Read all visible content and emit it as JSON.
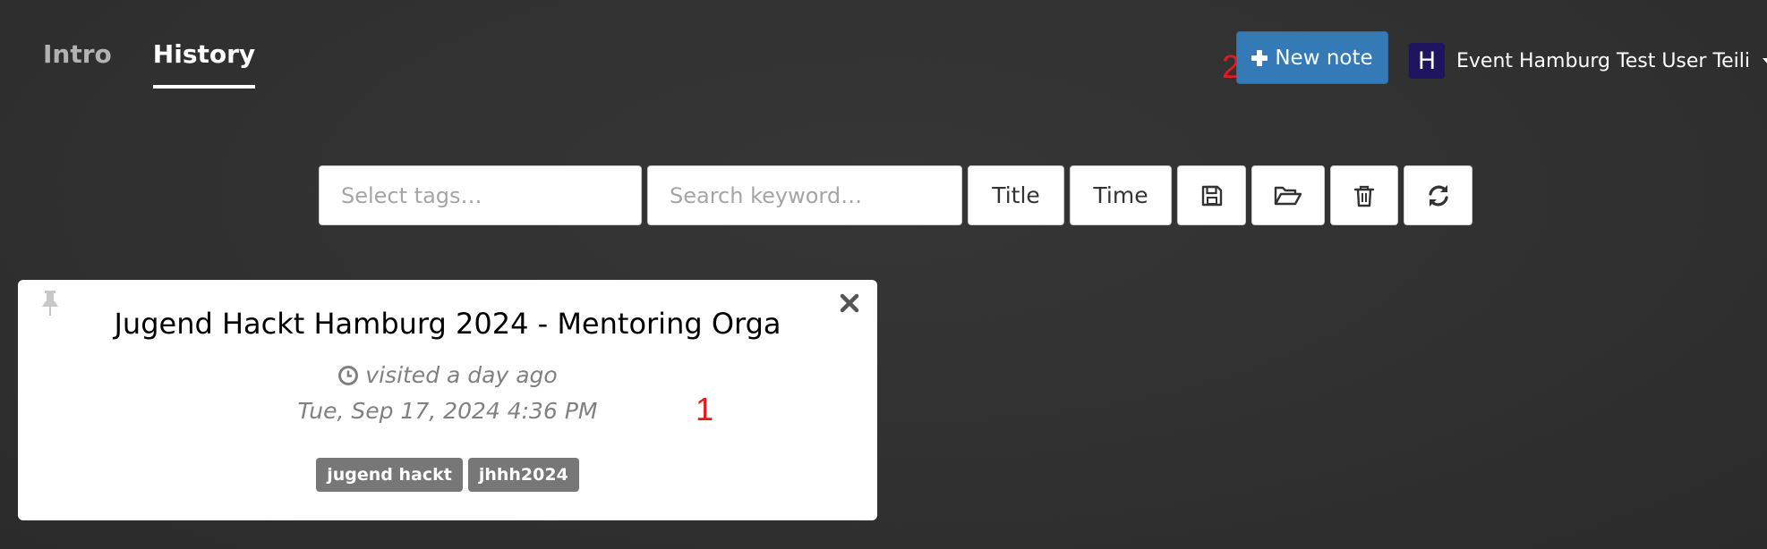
{
  "nav": {
    "tabs": [
      {
        "label": "Intro"
      },
      {
        "label": "History"
      }
    ]
  },
  "header": {
    "new_note_label": "New note",
    "user": {
      "avatar_letter": "H",
      "avatar_color": "#1f1460",
      "name": "Event Hamburg Test User Teili"
    }
  },
  "annotations": {
    "first": "1",
    "second": "2"
  },
  "toolbar": {
    "tags_placeholder": "Select tags…",
    "keyword_placeholder": "Search keyword…",
    "title_label": "Title",
    "time_label": "Time",
    "icons": [
      "save-icon",
      "folder-open-icon",
      "trash-icon",
      "refresh-icon"
    ]
  },
  "history": {
    "items": [
      {
        "title": "Jugend Hackt Hamburg 2024 - Mentoring Orga",
        "visited": "visited a day ago",
        "date": "Tue, Sep 17, 2024 4:36 PM",
        "tags": [
          "jugend hackt",
          "jhhh2024"
        ]
      }
    ]
  },
  "colors": {
    "background": "#353535",
    "primary": "#337ab7",
    "tag": "#777777",
    "annotation": "#e31b1b"
  }
}
